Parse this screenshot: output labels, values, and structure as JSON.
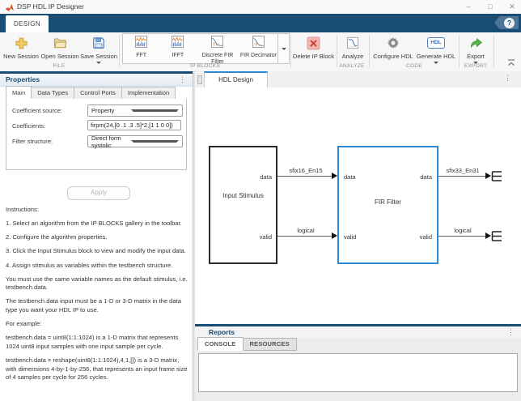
{
  "window": {
    "title": "DSP HDL IP Designer",
    "minimize": "–",
    "maximize": "□",
    "close": "✕",
    "help": "?"
  },
  "ribbon": {
    "tab_label": "DESIGN",
    "file": {
      "label": "FILE",
      "new_button": "New Session",
      "open_button": "Open Session",
      "save_button": "Save Session"
    },
    "ip_blocks": {
      "label": "IP BLOCKS",
      "items": [
        {
          "label": "FFT"
        },
        {
          "label": "IFFT"
        },
        {
          "label": "Discrete FIR Filter"
        },
        {
          "label": "FIR Decimator"
        }
      ]
    },
    "delete_button": "Delete IP Block",
    "analyze": {
      "label": "ANALYZE",
      "analyze_button": "Analyze"
    },
    "code": {
      "label": "CODE",
      "configure_button": "Configure HDL",
      "generate_button": "Generate HDL",
      "generate_badge": "HDL"
    },
    "export": {
      "label": "EXPORT",
      "export_button": "Export"
    }
  },
  "properties": {
    "title": "Properties",
    "tabs": [
      "Main",
      "Data Types",
      "Control Ports",
      "Implementation"
    ],
    "active_tab": "Main",
    "coefficient_source": {
      "label": "Coefficient source:",
      "value": "Property"
    },
    "coefficients": {
      "label": "Coefficients:",
      "value": "firpm(24,[0 .1 .3 .5]*2,[1 1 0 0])"
    },
    "filter_structure": {
      "label": "Filter structure:",
      "value": "Direct form systolic"
    },
    "apply_button": "Apply",
    "instructions": [
      "Instructions:",
      "1. Select an algorithm from the IP BLOCKS gallery in the toolbar.",
      "2. Configure the algorithm properties.",
      "3. Click the Input Stimulus block to view and modify the input data.",
      "4. Assign stimulus as variables within the testbench structure.",
      "You must use the same variable names as the default stimulus, i.e. testbench.data.",
      "The testbench.data input must be a 1-D or 3-D matrix in the data type you want your HDL IP to use.",
      "For example:",
      "testbench.data = uint8(1:1:1024) is a 1-D matrix that represents 1024 uint8 input samples with one input sample per cycle.",
      "testbench.data = reshape(uint8(1:1:1024),4,1,[]) is a 3-D matrix, with dimensions 4-by-1-by-256, that represents an input frame size of 4 samples per cycle for 256 cycles."
    ]
  },
  "canvas": {
    "tab_label": "HDL Design",
    "input_stimulus": {
      "label": "Input Stimulus",
      "out_data": "data",
      "out_valid": "valid"
    },
    "fir_filter": {
      "label": "FIR Filter",
      "in_data": "data",
      "in_valid": "valid",
      "out_data": "data",
      "out_valid": "valid"
    },
    "signals": {
      "stim_data": "sfix16_En15",
      "stim_valid": "logical",
      "out_data": "sfix33_En31",
      "out_valid": "logical"
    }
  },
  "reports": {
    "title": "Reports",
    "tabs": [
      "CONSOLE",
      "RESOURCES"
    ],
    "active_tab": "CONSOLE",
    "console_text": ""
  },
  "colors": {
    "navy": "#1a4d73",
    "accent_blue": "#2a8ad6",
    "fir_block_border": "#2a8ad6",
    "stim_block_border": "#2b2b2b",
    "delete_red": "#c0392b",
    "export_green": "#57b749",
    "icon_gold": "#efca5d",
    "icon_blue": "#4f7cb5"
  }
}
